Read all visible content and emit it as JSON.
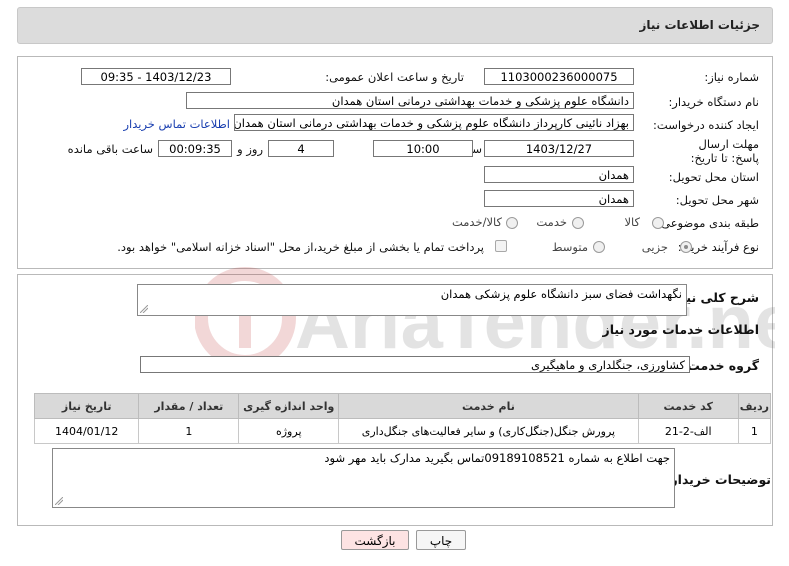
{
  "header": {
    "title": "جزئیات اطلاعات نیاز"
  },
  "form": {
    "need_number_label": "شماره نیاز:",
    "need_number": "1103000236000075",
    "announce_label": "تاریخ و ساعت اعلان عمومی:",
    "announce_value": "1403/12/23 - 09:35",
    "buyer_org_label": "نام دستگاه خریدار:",
    "buyer_org": "دانشگاه علوم پزشکی و خدمات بهداشتی درمانی استان همدان",
    "creator_label": "ایجاد کننده درخواست:",
    "creator": "بهزاد نائینی کارپرداز دانشگاه علوم پزشکی و خدمات بهداشتی درمانی استان همدان",
    "contact_link": "اطلاعات تماس خریدار",
    "deadline_label": "مهلت ارسال پاسخ: تا تاریخ:",
    "deadline_date": "1403/12/27",
    "time_label": "ساعت",
    "deadline_time": "10:00",
    "days_value": "4",
    "days_label": "روز و",
    "remaining_time": "00:09:35",
    "remaining_label": "ساعت باقی مانده",
    "province_label": "استان محل تحویل:",
    "province": "همدان",
    "city_label": "شهر محل تحویل:",
    "city": "همدان",
    "category_label": "طبقه بندی موضوعی:",
    "category_options": [
      "کالا",
      "خدمت",
      "کالا/خدمت"
    ],
    "category_selected": "خدمت",
    "process_label": "نوع فرآیند خرید :",
    "process_options": [
      "جزیی",
      "متوسط"
    ],
    "process_selected": "جزیی",
    "payment_note": "پرداخت تمام یا بخشی از مبلغ خرید،از محل \"اسناد خزانه اسلامی\" خواهد بود."
  },
  "summary": {
    "label": "شرح کلی نیاز:",
    "value": "نگهداشت فضای سبز دانشگاه علوم پزشکی همدان"
  },
  "services": {
    "section_title": "اطلاعات خدمات مورد نیاز",
    "group_label": "گروه خدمت:",
    "group_value": "کشاورزی، جنگلداری و ماهیگیری",
    "columns": [
      "ردیف",
      "کد خدمت",
      "نام خدمت",
      "واحد اندازه گیری",
      "تعداد / مقدار",
      "تاریخ نیاز"
    ],
    "rows": [
      {
        "row": "1",
        "code": "الف-2-21",
        "name": "پرورش جنگل(جنگل‌کاری) و سایر فعالیت‌های جنگل‌داری",
        "unit": "پروژه",
        "qty": "1",
        "date": "1404/01/12"
      }
    ]
  },
  "buyer_notes": {
    "label": "توضیحات خریدار:",
    "value": "جهت اطلاع به شماره 09189108521تماس بگیرید مدارک باید مهر شود"
  },
  "buttons": {
    "print": "چاپ",
    "back": "بازگشت"
  },
  "watermark": {
    "text": "AriaTender.neT"
  },
  "colors": {
    "link": "#1a3fb0",
    "back_button_bg": "#fde3e3",
    "header_bg": "#dcdcdc"
  }
}
